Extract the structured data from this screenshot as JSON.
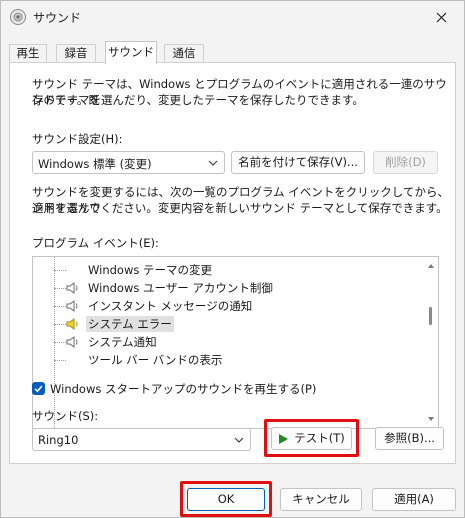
{
  "window": {
    "title": "サウンド",
    "icon": "speaker-window-icon"
  },
  "tabs": [
    {
      "label": "再生",
      "active": false
    },
    {
      "label": "録音",
      "active": false
    },
    {
      "label": "サウンド",
      "active": true
    },
    {
      "label": "通信",
      "active": false
    }
  ],
  "theme": {
    "description_line1": "サウンド テーマは、Windows とプログラムのイベントに適用される一連のサウンドです。既",
    "description_line2": "存のテーマを選んだり、変更したテーマを保存したりできます。",
    "label": "サウンド設定(H):",
    "selected": "Windows 標準 (変更)",
    "save_as_label": "名前を付けて保存(V)...",
    "delete_label": "削除(D)"
  },
  "events_help": {
    "line1": "サウンドを変更するには、次の一覧のプログラム イベントをクリックしてから、適用するサウ",
    "line2": "ンドを選んでください。変更内容を新しいサウンド テーマとして保存できます。"
  },
  "program_events": {
    "label": "プログラム イベント(E):",
    "items": [
      {
        "label": "Windows テーマの変更",
        "icon": "none",
        "selected": false
      },
      {
        "label": "Windows ユーザー アカウント制御",
        "icon": "speaker-icon",
        "selected": false
      },
      {
        "label": "インスタント メッセージの通知",
        "icon": "speaker-icon",
        "selected": false
      },
      {
        "label": "システム エラー",
        "icon": "speaker-yellow-icon",
        "selected": true
      },
      {
        "label": "システム通知",
        "icon": "speaker-icon",
        "selected": false
      },
      {
        "label": "ツール バー バンドの表示",
        "icon": "none",
        "selected": false
      }
    ]
  },
  "startup": {
    "label": "Windows スタートアップのサウンドを再生する(P)",
    "checked": true
  },
  "sound": {
    "label": "サウンド(S):",
    "selected": "Ring10",
    "test_label": "テスト(T)",
    "browse_label": "参照(B)..."
  },
  "footer": {
    "ok": "OK",
    "cancel": "キャンセル",
    "apply": "適用(A)"
  },
  "colors": {
    "accent": "#005fb8",
    "highlight": "#e01010",
    "play": "#1e8c1e"
  }
}
